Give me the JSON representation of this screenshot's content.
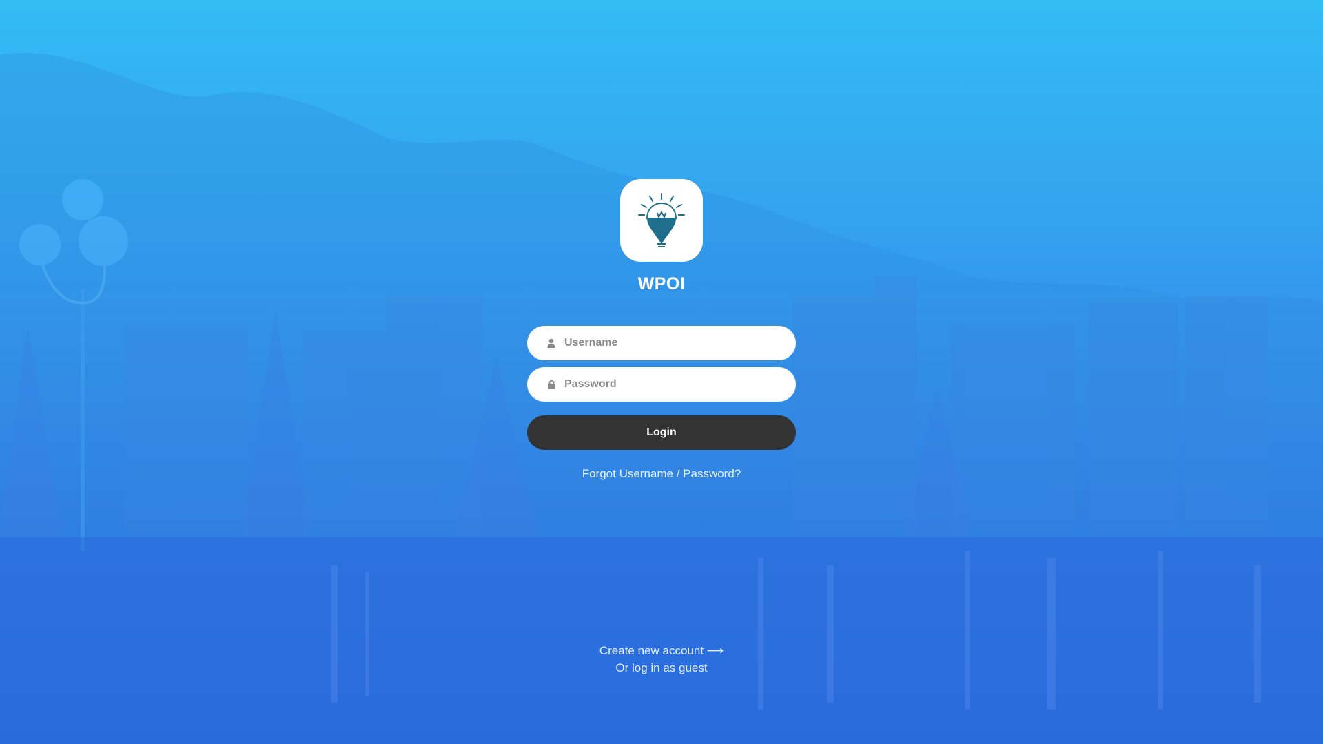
{
  "app": {
    "name": "WPOI",
    "logo_icon": "lightbulb-location-pin-icon"
  },
  "form": {
    "username_placeholder": "Username",
    "password_placeholder": "Password",
    "username_icon": "user-icon",
    "password_icon": "lock-icon",
    "login_label": "Login",
    "forgot_label": "Forgot Username / Password?"
  },
  "footer": {
    "create_account_label": "Create new account ⟶",
    "guest_label": "Or log in as guest"
  },
  "colors": {
    "background_top": "#33bcf4",
    "background_bottom": "#2a5fdb",
    "button": "#333333",
    "logo_accent": "#1f6e8c"
  }
}
